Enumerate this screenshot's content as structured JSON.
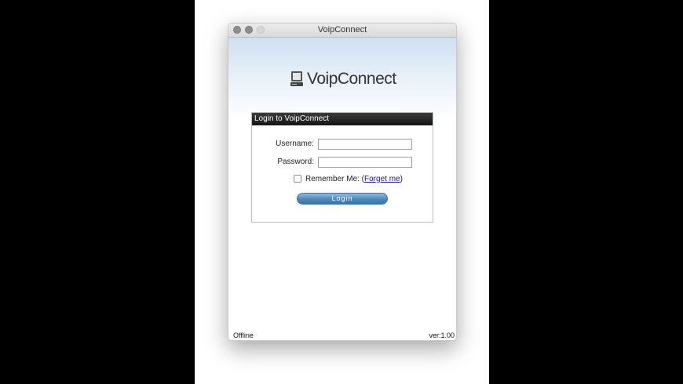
{
  "window": {
    "title": "VoipConnect"
  },
  "logo": {
    "icon": "computer-icon",
    "text": "VoipConnect"
  },
  "login_panel": {
    "header": "Login to VoipConnect",
    "username_label": "Username:",
    "username_value": "",
    "password_label": "Password:",
    "password_value": "",
    "remember_label": "Remember Me: (",
    "forget_link": "Forget me",
    "remember_close": ")",
    "remember_checked": false,
    "login_button": "Login"
  },
  "status": {
    "connection": "Offline",
    "version": "ver:1.00"
  },
  "colors": {
    "header_gradient_top": "#cfe0f1",
    "panel_header": "#1e1e1e",
    "login_button": "#4f86b9",
    "link": "#1a0dab"
  }
}
